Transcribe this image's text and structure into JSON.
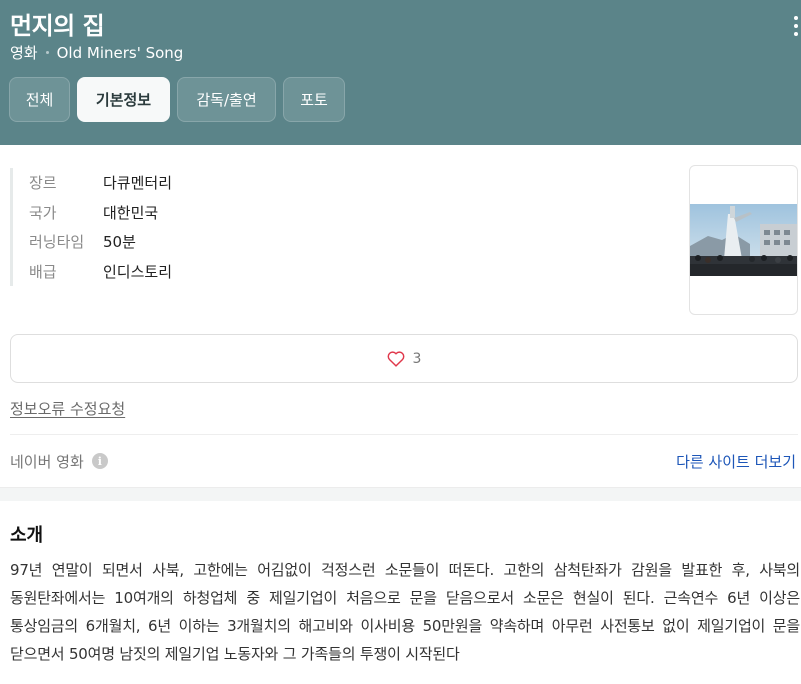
{
  "header": {
    "title": "먼지의 집",
    "category": "영화",
    "original_title": "Old Miners' Song",
    "tabs": [
      {
        "label": "전체",
        "active": false
      },
      {
        "label": "기본정보",
        "active": true
      },
      {
        "label": "감독/출연",
        "active": false
      },
      {
        "label": "포토",
        "active": false
      }
    ]
  },
  "info": {
    "rows": [
      {
        "label": "장르",
        "value": "다큐멘터리"
      },
      {
        "label": "국가",
        "value": "대한민국"
      },
      {
        "label": "러닝타임",
        "value": "50분"
      },
      {
        "label": "배급",
        "value": "인디스토리"
      }
    ]
  },
  "like": {
    "count": "3"
  },
  "report_link": "정보오류 수정요청",
  "source": {
    "label": "네이버 영화",
    "more_sites": "다른 사이트 더보기"
  },
  "intro": {
    "title": "소개",
    "text": "97년 연말이 되면서 사북, 고한에는 어김없이 걱정스런 소문들이 떠돈다. 고한의 삼척탄좌가 감원을 발표한 후, 사북의 동원탄좌에서는 10여개의 하청업체 중 제일기업이 처음으로 문을 닫음으로서 소문은 현실이 된다. 근속연수 6년 이상은 통상임금의 6개월치, 6년 이하는 3개월치의 해고비와 이사비용 50만원을 약속하며 아무런 사전통보 없이 제일기업이 문을 닫으면서 50여명 남짓의 제일기업 노동자와 그 가족들의 투쟁이 시작된다"
  },
  "colors": {
    "header_bg": "#5b8489",
    "link_blue": "#1d56b8",
    "heart": "#e0384b"
  }
}
